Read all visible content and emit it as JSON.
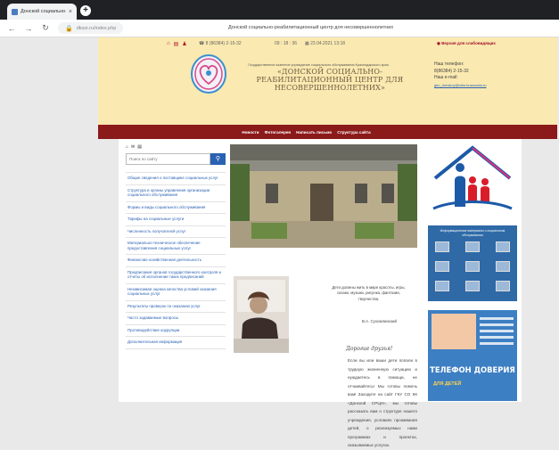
{
  "browser": {
    "tab_title": "Донской социально-р",
    "tab_close": "×",
    "new_tab": "+",
    "url": "dkssr.ru/index.php",
    "nav_back": "←",
    "nav_forward": "→",
    "nav_reload": "↻"
  },
  "page_title": "Донской социально-реабилитационный центр для несовершеннолетних",
  "header": {
    "phone": "8 (86384) 2-15-32",
    "time": "09 : 18 : 36",
    "date": "23.04.2021 13:18",
    "vision_link": "Версия для слабовидящих",
    "org_subtitle": "Государственное казенное учреждение социального обслуживания Краснодарского края",
    "org_name": "«ДОНСКОЙ СОЦИАЛЬНО-РЕАБИЛИТАЦИОННЫЙ ЦЕНТР ДЛЯ НЕСОВЕРШЕННОЛЕТНИХ»",
    "contact_phone_label": "Наш телефон:",
    "contact_phone": "8(86384) 2-15-32",
    "contact_email_label": "Наш e-mail:",
    "contact_email": "gku_donskoy@mtsr.krasnodar.ru"
  },
  "topnav": [
    "Новости",
    "Фотогалерея",
    "Написать письмо",
    "Структура сайта"
  ],
  "sidebar": {
    "search_placeholder": "Поиск по сайту",
    "search_icon": "⚲",
    "items": [
      "Общие сведения о поставщике социальных услуг",
      "Структура и органы управления организации социального обслуживания",
      "Формы и виды социального обслуживания",
      "Тарифы на социальные услуги",
      "Численность получателей услуг",
      "Материально-техническое обеспечение предоставления социальных услуг",
      "Финансово-хозяйственная деятельность",
      "Предписания органов государственного контроля и отчеты об исполнении таких предписаний",
      "Независимая оценка качества условий оказания социальных услуг",
      "Результаты проверок по оказанию услуг",
      "Часто задаваемые вопросы",
      "Противодействие коррупции",
      "Дополнительная информация"
    ]
  },
  "main": {
    "quote": "Дети должны жить в мире красоты, игры, сказки, музыки, рисунка, фантазии, творчества.",
    "quote_author": "В.А. Сухомлинский",
    "greeting": "Дорогие друзья!",
    "body_text": "Если вы или ваши дети попали в трудную жизненную ситуацию и нуждаетесь в помощи, не отчаивайтесь! Мы готовы помочь вам! Заходите на сайт ГКУ СО КК «Донской СРЦН», мы готовы рассказать вам о структуре нашего учреждения, условиях проживания детей, о реализуемых нами программах и проектах, оказываемых услугах."
  },
  "right": {
    "banner_title": "Информационные материалы о социальном обслуживании",
    "trust_title": "ТЕЛЕФОН ДОВЕРИЯ",
    "trust_sub": "ДЛЯ ДЕТЕЙ"
  },
  "colors": {
    "header_bg": "#fae9b0",
    "nav_bg": "#8b1a1a",
    "link": "#2a62b3",
    "accent_red": "#b0142e"
  }
}
